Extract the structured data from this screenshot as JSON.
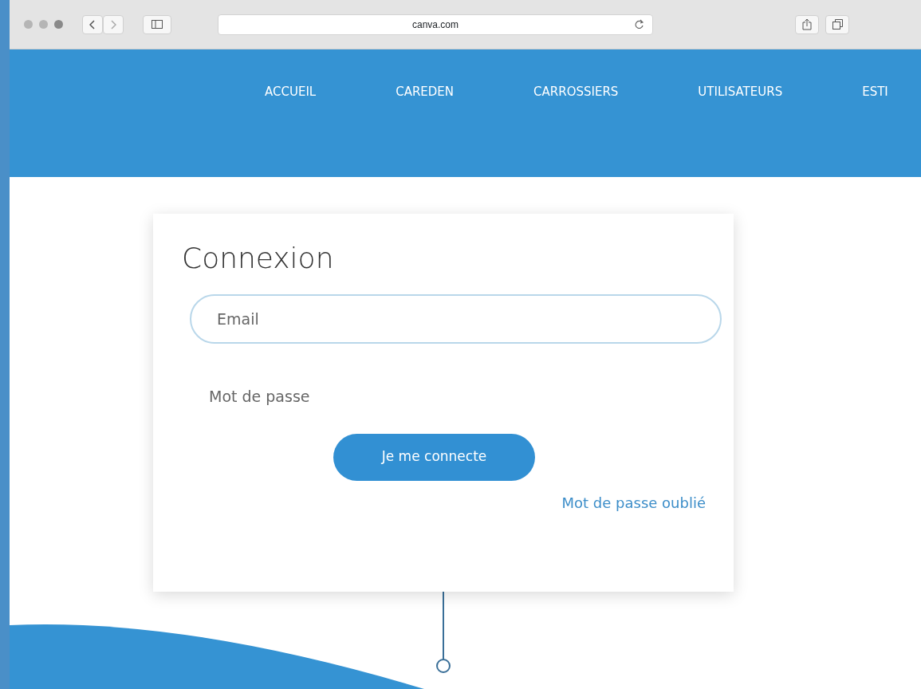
{
  "browser": {
    "url": "canva.com"
  },
  "nav": {
    "items": [
      {
        "label": "ACCUEIL"
      },
      {
        "label": "CAREDEN"
      },
      {
        "label": "CARROSSIERS"
      },
      {
        "label": "UTILISATEURS"
      },
      {
        "label": "ESTI"
      }
    ]
  },
  "login": {
    "title": "Connexion",
    "email": {
      "placeholder": "Email"
    },
    "password": {
      "placeholder": "Mot de passe"
    },
    "submit": "Je me connecte",
    "forgot": "Mot de passe oublié"
  }
}
